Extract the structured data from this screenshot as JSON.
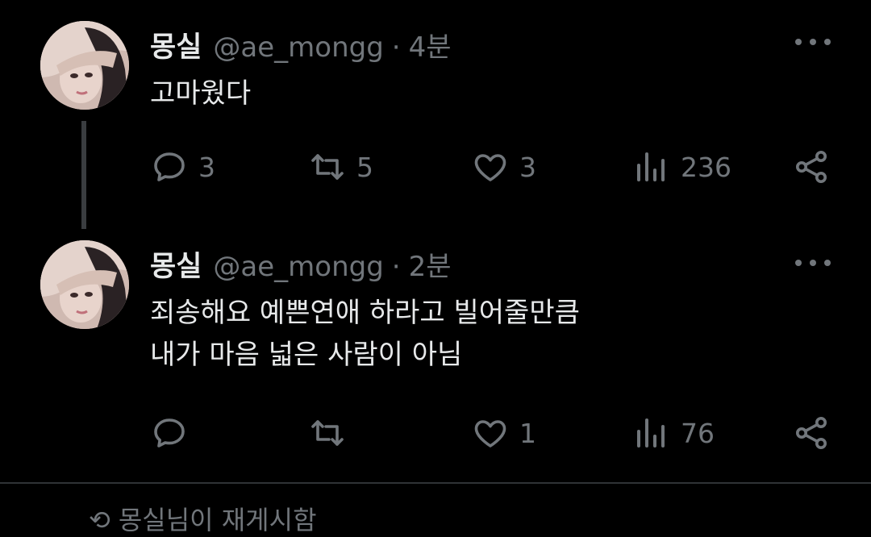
{
  "tweets": [
    {
      "name": "몽실",
      "handle": "@ae_mongg",
      "time": "4분",
      "text_lines": [
        "고마웠다"
      ],
      "replies": "3",
      "retweets": "5",
      "likes": "3",
      "views": "236"
    },
    {
      "name": "몽실",
      "handle": "@ae_mongg",
      "time": "2분",
      "text_lines": [
        "죄송해요 예쁜연애 하라고 빌어줄만큼",
        "내가 마음 넓은 사람이 아님"
      ],
      "replies": "",
      "retweets": "",
      "likes": "1",
      "views": "76"
    }
  ],
  "next_item": "몽실님이 재게시함",
  "colors": {
    "background": "#000000",
    "text": "#e7e9ea",
    "muted": "#71767b"
  },
  "icons": [
    "reply-icon",
    "retweet-icon",
    "like-icon",
    "views-icon",
    "share-icon",
    "more-icon"
  ]
}
